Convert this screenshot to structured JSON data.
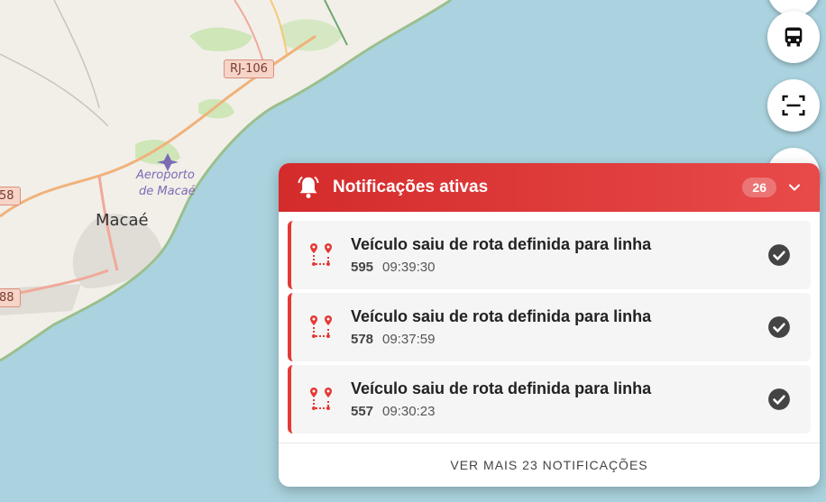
{
  "map": {
    "road_label": "RJ-106",
    "road_edge_1": "58",
    "road_edge_2": "88",
    "airport_label_1": "Aeroporto",
    "airport_label_2": "de Macaé",
    "city_label": "Macaé"
  },
  "buttons": {
    "bus_icon": "bus-icon",
    "scan_icon": "scan-icon"
  },
  "panel": {
    "title": "Notificações ativas",
    "count": "26",
    "footer": "VER MAIS 23 NOTIFICAÇÕES",
    "accent": "#e53935",
    "notifications": [
      {
        "title": "Veículo saiu de rota definida para linha",
        "vehicle": "595",
        "time": "09:39:30"
      },
      {
        "title": "Veículo saiu de rota definida para linha",
        "vehicle": "578",
        "time": "09:37:59"
      },
      {
        "title": "Veículo saiu de rota definida para linha",
        "vehicle": "557",
        "time": "09:30:23"
      }
    ]
  }
}
